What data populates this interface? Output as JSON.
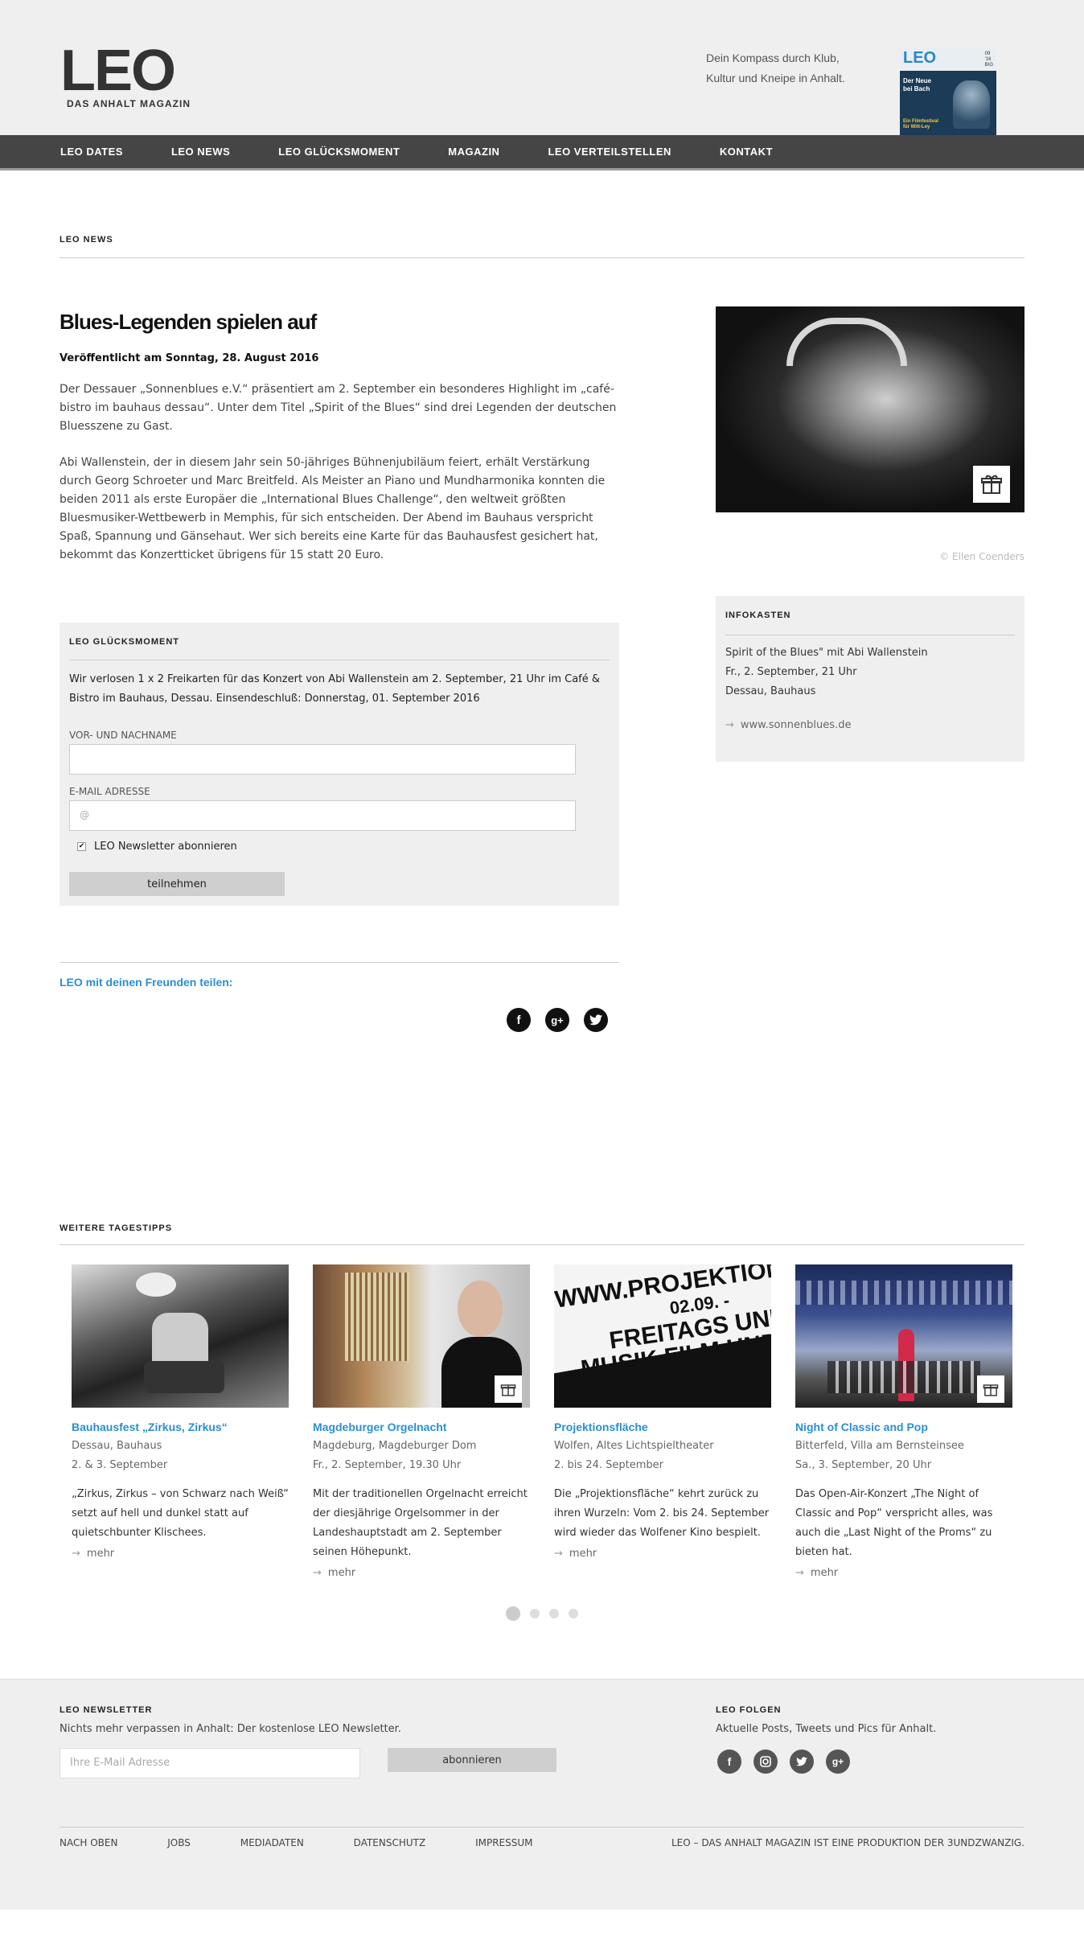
{
  "header": {
    "logo": "LEO",
    "logo_sub": "DAS ANHALT MAGAZIN",
    "tagline_line1": "Dein Kompass durch Klub,",
    "tagline_line2": "Kultur und Kneipe in Anhalt.",
    "cover": {
      "title": "LEO",
      "side": "09\n'16\nBIG",
      "text1": "Der Neue",
      "text2": "bei Bach",
      "bottom1": "Ein Filmfestival",
      "bottom2": "für Witt-Ley"
    }
  },
  "nav": [
    "LEO DATES",
    "LEO NEWS",
    "LEO GLÜCKSMOMENT",
    "MAGAZIN",
    "LEO VERTEILSTELLEN",
    "KONTAKT"
  ],
  "news_section": "LEO NEWS",
  "article": {
    "title": "Blues-Legenden spielen auf",
    "date": "Veröffentlicht am Sonntag, 28. August 2016",
    "p1": "Der Dessauer „Sonnenblues e.V.“ präsentiert am 2. September ein besonderes Highlight im „café-bistro im bauhaus dessau“. Unter dem Titel „Spirit of the Blues“ sind drei Legenden der deutschen Bluesszene zu Gast.",
    "p2": "Abi Wallenstein, der in diesem Jahr sein 50-jähriges Bühnenjubiläum feiert, erhält Verstärkung durch Georg Schroeter und Marc Breitfeld. Als Meister an Piano und Mundharmonika konnten die beiden 2011 als erste Europäer die „International Blues Challenge“, den weltweit größten Bluesmusiker-Wettbewerb in Memphis, für sich entscheiden. Der Abend im Bauhaus verspricht Spaß, Spannung und Gänsehaut. Wer sich bereits eine Karte für das Bauhausfest gesichert hat, bekommt das Konzertticket übrigens für 15 statt 20 Euro."
  },
  "photo_credit": "© Ellen Coenders",
  "infokasten": {
    "label": "INFOKASTEN",
    "line1": "Spirit of the Blues\" mit Abi Wallenstein",
    "line2": "Fr., 2. September, 21 Uhr",
    "line3": "Dessau, Bauhaus",
    "link": "www.sonnenblues.de"
  },
  "contest": {
    "label": "LEO GLÜCKSMOMENT",
    "text": "Wir verlosen 1 x 2 Freikarten für das Konzert von Abi Wallenstein am 2. September, 21 Uhr im Café & Bistro im Bauhaus, Dessau. Einsendeschluß: Donnerstag, 01. September 2016",
    "name_label": "VOR- UND NACHNAME",
    "email_label": "E-MAIL ADRESSE",
    "email_placeholder": "@",
    "newsletter_label": "LEO Newsletter abonnieren",
    "newsletter_checked": "✔",
    "submit": "teilnehmen"
  },
  "share": {
    "label": "LEO mit deinen Freunden teilen:",
    "icons": [
      "facebook-icon",
      "google-plus-icon",
      "twitter-icon"
    ]
  },
  "tips_section": "WEITERE TAGESTIPPS",
  "tips": [
    {
      "title": "Bauhausfest „Zirkus, Zirkus“",
      "place": "Dessau, Bauhaus",
      "date": "2. & 3. September",
      "desc": "„Zirkus, Zirkus – von Schwarz nach Weiß“ setzt auf hell und dunkel statt auf quietschbunter Klischees.",
      "more": "mehr"
    },
    {
      "title": "Magdeburger Orgelnacht",
      "place": "Magdeburg, Magdeburger Dom",
      "date": "Fr., 2. September, 19.30 Uhr",
      "desc": "Mit der traditionellen Orgelnacht erreicht der diesjährige Orgelsommer in der Landeshauptstadt am 2. September seinen Höhepunkt.",
      "more": "mehr"
    },
    {
      "title": "Projektionsfläche",
      "place": "Wolfen, Altes Lichtspieltheater",
      "date": "2. bis 24. September",
      "desc": "Die „Projektionsfläche“ kehrt zurück zu ihren Wurzeln: Vom 2. bis 24. September wird wieder das Wolfener Kino bespielt.",
      "more": "mehr"
    },
    {
      "title": "Night of Classic and Pop",
      "place": "Bitterfeld, Villa am Bernsteinsee",
      "date": "Sa., 3. September, 20 Uhr",
      "desc": "Das Open-Air-Konzert „The Night of Classic and Pop“ verspricht alles, was auch die „Last Night of the Proms“ zu bieten hat.",
      "more": "mehr"
    }
  ],
  "tip3_sign": {
    "line1": "WWW.PROJEKTIONS",
    "line2": "02.09. -",
    "line3": "FREITAGS UND",
    "line4": "MUSIK.FILM UND"
  },
  "footer": {
    "newsletter_label": "LEO NEWSLETTER",
    "newsletter_text": "Nichts mehr verpassen in Anhalt: Der kostenlose LEO Newsletter.",
    "email_placeholder": "Ihre E-Mail Adresse",
    "subscribe": "abonnieren",
    "follow_label": "LEO FOLGEN",
    "follow_text": "Aktuelle Posts, Tweets und Pics für Anhalt.",
    "links": [
      "NACH OBEN",
      "JOBS",
      "MEDIADATEN",
      "DATENSCHUTZ",
      "IMPRESSUM"
    ],
    "credit": "LEO – DAS ANHALT MAGAZIN IST EINE PRODUKTION DER 3UNDZWANZIG."
  },
  "colors": {
    "accent_blue": "#2b8fd1",
    "nav_bg": "#454545",
    "panel_bg": "#efefef"
  }
}
